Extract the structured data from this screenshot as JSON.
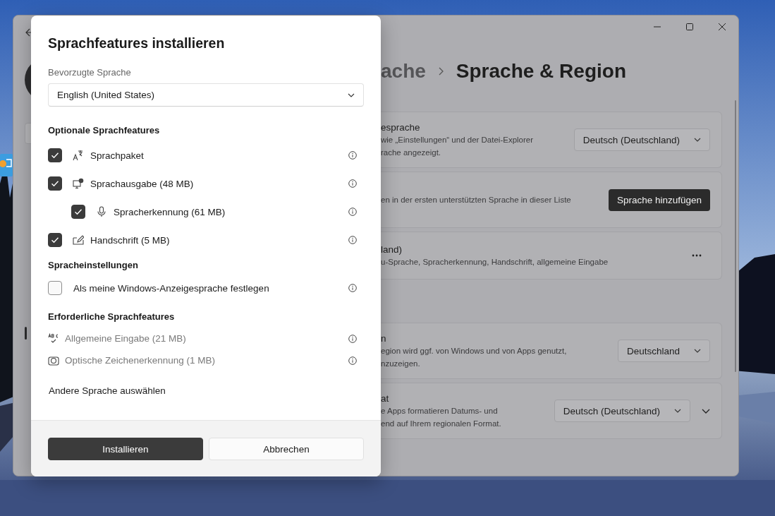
{
  "settings": {
    "breadcrumb": {
      "parent": "ache",
      "current": "Sprache & Region"
    },
    "cards": [
      {
        "kind": "dropdown",
        "title": "esprache",
        "lines": [
          "wie „Einstellungen“ und der Datei-Explorer",
          "rache angezeigt."
        ],
        "control": "Deutsch (Deutschland)"
      },
      {
        "kind": "button",
        "lines": [
          "en in der ersten unterstützten Sprache in dieser Liste"
        ],
        "control": "Sprache hinzufügen"
      },
      {
        "kind": "more",
        "title": "land)",
        "lines": [
          "u-Sprache, Spracherkennung, Handschrift, allgemeine Eingabe"
        ]
      },
      {
        "kind": "dropdown",
        "title": "n",
        "lines": [
          "egion wird ggf. von Windows und von Apps genutzt,",
          "nzuzeigen."
        ],
        "control": "Deutschland"
      },
      {
        "kind": "expand",
        "title": "at",
        "lines": [
          "e Apps formatieren Datums- und",
          "end auf Ihrem regionalen Format."
        ],
        "control": "Deutsch (Deutschland)"
      }
    ]
  },
  "dialog": {
    "title": "Sprachfeatures installieren",
    "preferred_language": {
      "label": "Bevorzugte Sprache",
      "value": "English (United States)"
    },
    "optional": {
      "heading": "Optionale Sprachfeatures",
      "items": [
        {
          "kind": "pack",
          "label": "Sprachpaket",
          "checked": true
        },
        {
          "kind": "speech",
          "label": "Sprachausgabe (48 MB)",
          "checked": true,
          "children": [
            {
              "kind": "mic",
              "label": "Spracherkennung (61 MB)",
              "checked": true
            }
          ]
        },
        {
          "kind": "pen",
          "label": "Handschrift (5 MB)",
          "checked": true
        }
      ]
    },
    "language_settings": {
      "heading": "Spracheinstellungen",
      "items": [
        {
          "label": "Als meine Windows-Anzeigesprache festlegen",
          "checked": false
        }
      ]
    },
    "required": {
      "heading": "Erforderliche Sprachfeatures",
      "items": [
        {
          "kind": "abc",
          "label": "Allgemeine Eingabe (21 MB)"
        },
        {
          "kind": "camera",
          "label": "Optische Zeichenerkennung (1 MB)"
        }
      ]
    },
    "link": "Andere Sprache auswählen",
    "buttons": [
      {
        "kind": "primary",
        "label": "Installieren"
      },
      {
        "kind": "secondary",
        "label": "Abbrechen"
      }
    ]
  }
}
